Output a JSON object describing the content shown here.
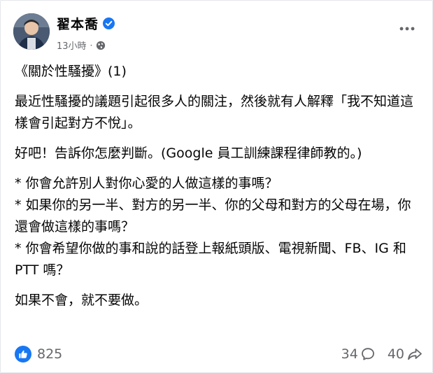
{
  "post": {
    "author_name": "翟本喬",
    "verified": true,
    "timestamp": "13小時",
    "separator": "·",
    "privacy_icon": "globe-icon",
    "more_icon": "ellipsis-icon",
    "paragraphs": [
      "《關於性騷擾》(1)",
      "最近性騷擾的議題引起很多人的關注，然後就有人解釋「我不知道這樣會引起對方不悅」。",
      "好吧！告訴你怎麼判斷。(Google 員工訓練課程律師教的。)",
      "* 你會允許別人對你心愛的人做這樣的事嗎？",
      "* 如果你的另一半、對方的另一半、你的父母和對方的父母在場，你還會做這樣的事嗎？",
      "* 你會希望你做的事和說的話登上報紙頭版、電視新聞、FB、IG 和 PTT 嗎？",
      "如果不會，就不要做。"
    ]
  },
  "footer": {
    "like_count": "825",
    "comment_count": "34",
    "share_count": "40",
    "like_icon": "thumbs-up-icon",
    "comment_icon": "comment-icon",
    "share_icon": "share-icon"
  },
  "colors": {
    "accent": "#1877f2",
    "secondary_text": "#65676b",
    "primary_text": "#050505"
  }
}
